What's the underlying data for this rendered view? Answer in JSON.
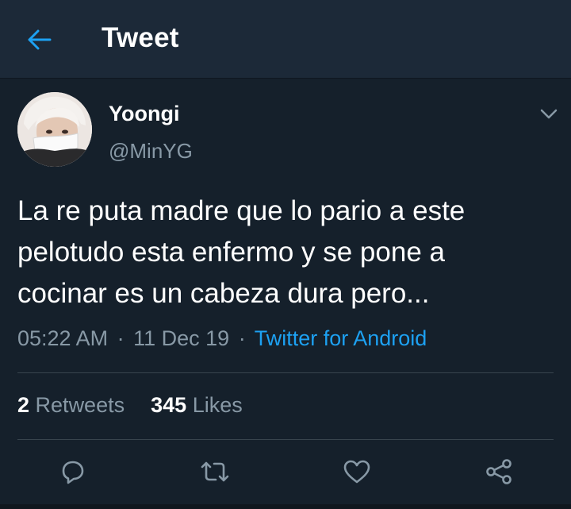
{
  "header": {
    "title": "Tweet",
    "back_icon": "arrow-left-icon"
  },
  "tweet": {
    "author": {
      "name": "Yoongi",
      "handle": "@MinYG"
    },
    "text_lines": [
      "La re puta madre que lo pario a este",
      "pelotudo esta enfermo y se pone a",
      "cocinar es un cabeza dura pero..."
    ],
    "time": "05:22 AM",
    "date": "11 Dec 19",
    "separator": "·",
    "source": "Twitter for Android",
    "stats": {
      "retweets_count": "2",
      "retweets_label": "Retweets",
      "likes_count": "345",
      "likes_label": "Likes"
    }
  },
  "actions": [
    "reply-icon",
    "retweet-icon",
    "like-icon",
    "share-icon"
  ],
  "colors": {
    "background": "#15202b",
    "header": "#1c2938",
    "accent": "#1da1f2",
    "secondary_text": "#8899a6"
  }
}
